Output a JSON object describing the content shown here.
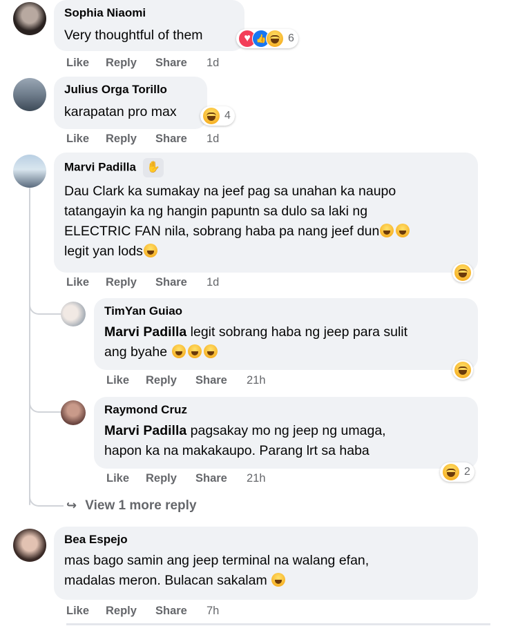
{
  "labels": {
    "like": "Like",
    "reply": "Reply",
    "share": "Share"
  },
  "comments": [
    {
      "name": "Sophia Niaomi",
      "text": "Very thoughtful of them",
      "time": "1d",
      "reactions": [
        "heart",
        "like",
        "haha"
      ],
      "reaction_count": "6"
    },
    {
      "name": "Julius Orga Torillo",
      "text": "karapatan pro max",
      "time": "1d",
      "reactions": [
        "haha"
      ],
      "reaction_count": "4"
    },
    {
      "name": "Marvi Padilla",
      "lines": [
        "Dau Clark ka sumakay na jeef pag sa unahan ka naupo",
        "tatangayin ka ng hangin papuntn sa dulo sa laki ng",
        "ELECTRIC FAN nila, sobrang haba pa nang jeef dun",
        "legit yan lods"
      ],
      "time": "1d",
      "reactions": [
        "haha"
      ],
      "badge_icon": "waving-hand-icon"
    },
    {
      "name": "Bea Espejo",
      "lines": [
        "mas bago samin ang jeep terminal na walang efan,",
        "madalas meron. Bulacan sakalam"
      ],
      "time": "7h"
    }
  ],
  "replies": [
    {
      "name": "TimYan Guiao",
      "mention": "Marvi Padilla",
      "lines": [
        " legit sobrang haba ng jeep para sulit",
        "ang byahe "
      ],
      "time": "21h",
      "reactions": [
        "haha"
      ]
    },
    {
      "name": "Raymond Cruz",
      "mention": "Marvi Padilla",
      "lines": [
        " pagsakay mo ng jeep ng umaga,",
        "hapon ka na makakaupo. Parang lrt sa haba"
      ],
      "time": "21h",
      "reactions": [
        "haha"
      ],
      "reaction_count": "2"
    }
  ],
  "view_more": "View 1 more reply",
  "colors": {
    "bubble": "#f0f2f5",
    "meta": "#65676b",
    "text": "#050505",
    "haha": "#f7b125",
    "heart": "#f33e58",
    "like": "#1877f2"
  }
}
